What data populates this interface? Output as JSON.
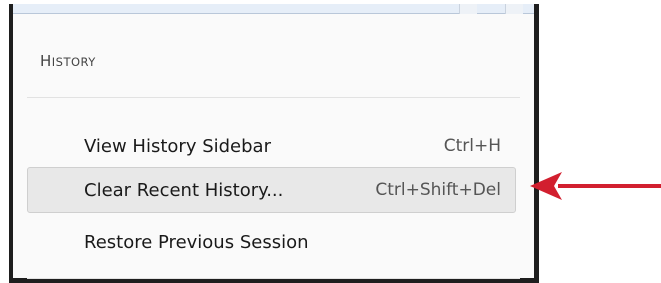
{
  "menu": {
    "section_title_cap": "H",
    "section_title_rest": "istory",
    "items": [
      {
        "label": "View History Sidebar",
        "shortcut": "Ctrl+H"
      },
      {
        "label": "Clear Recent History...",
        "shortcut": "Ctrl+Shift+Del",
        "highlighted": true
      },
      {
        "label": "Restore Previous Session",
        "shortcut": ""
      }
    ]
  },
  "annotation": {
    "icon": "arrow-left-icon",
    "color": "#d21f2f"
  }
}
